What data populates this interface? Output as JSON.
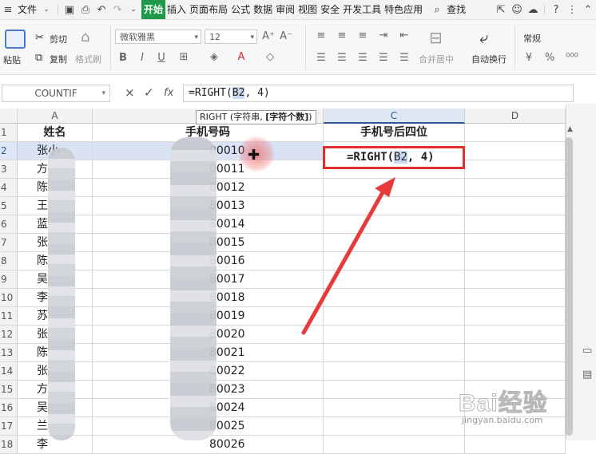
{
  "menu": {
    "file": "文件",
    "tabs": [
      "开始",
      "插入",
      "页面布局",
      "公式",
      "数据",
      "审阅",
      "视图",
      "安全",
      "开发工具",
      "特色应用"
    ],
    "active_tab": "开始",
    "search": "查找"
  },
  "ribbon": {
    "paste": "粘贴",
    "cut": "剪切",
    "copy": "复制",
    "format_painter": "格式刷",
    "font_name": "微软雅黑",
    "font_size": "12",
    "merge_center": "合并居中",
    "wrap_text": "自动换行",
    "number_format": "常规"
  },
  "formula_bar": {
    "name_box": "COUNTIF",
    "cancel": "×",
    "confirm": "✓",
    "fx": "fx",
    "formula_prefix": "=RIGHT(",
    "formula_ref": "B2",
    "formula_suffix": ", 4)"
  },
  "tooltip": {
    "text": "RIGHT (字符串, ",
    "bold": "[字符个数]",
    "close": ")"
  },
  "grid": {
    "columns": [
      "A",
      "B",
      "C",
      "D"
    ],
    "headers": [
      "姓名",
      "手机号码",
      "手机号后四位"
    ],
    "rows": [
      {
        "n": "1"
      },
      {
        "n": "2",
        "a": "张小",
        "b": "00010"
      },
      {
        "n": "3",
        "a": "方",
        "b": "00011"
      },
      {
        "n": "4",
        "a": "陈",
        "b": "80012"
      },
      {
        "n": "5",
        "a": "王",
        "b": "80013"
      },
      {
        "n": "6",
        "a": "蓝",
        "b": "80014"
      },
      {
        "n": "7",
        "a": "张",
        "b": "80015"
      },
      {
        "n": "8",
        "a": "陈",
        "b": "80016"
      },
      {
        "n": "9",
        "a": "吴",
        "b": "80017"
      },
      {
        "n": "10",
        "a": "李",
        "b": "80018"
      },
      {
        "n": "11",
        "a": "苏",
        "b": "80019"
      },
      {
        "n": "12",
        "a": "张",
        "b": "80020"
      },
      {
        "n": "13",
        "a": "陈",
        "b": "80021"
      },
      {
        "n": "14",
        "a": "张",
        "b": "80022"
      },
      {
        "n": "15",
        "a": "方",
        "b": "80023"
      },
      {
        "n": "16",
        "a": "吴",
        "b": "80024"
      },
      {
        "n": "17",
        "a": "兰",
        "b": "80025"
      },
      {
        "n": "18",
        "a": "李",
        "b": "80026"
      }
    ],
    "editing": {
      "prefix": "=RIGHT(",
      "ref": "B2",
      "suffix": ", 4)"
    }
  },
  "watermark": {
    "brand": "Bai经验",
    "url": "jingyan.baidu.com"
  },
  "colors": {
    "accent": "#1f9a4b",
    "selection": "#2b5797",
    "highlight": "#e0312f"
  }
}
